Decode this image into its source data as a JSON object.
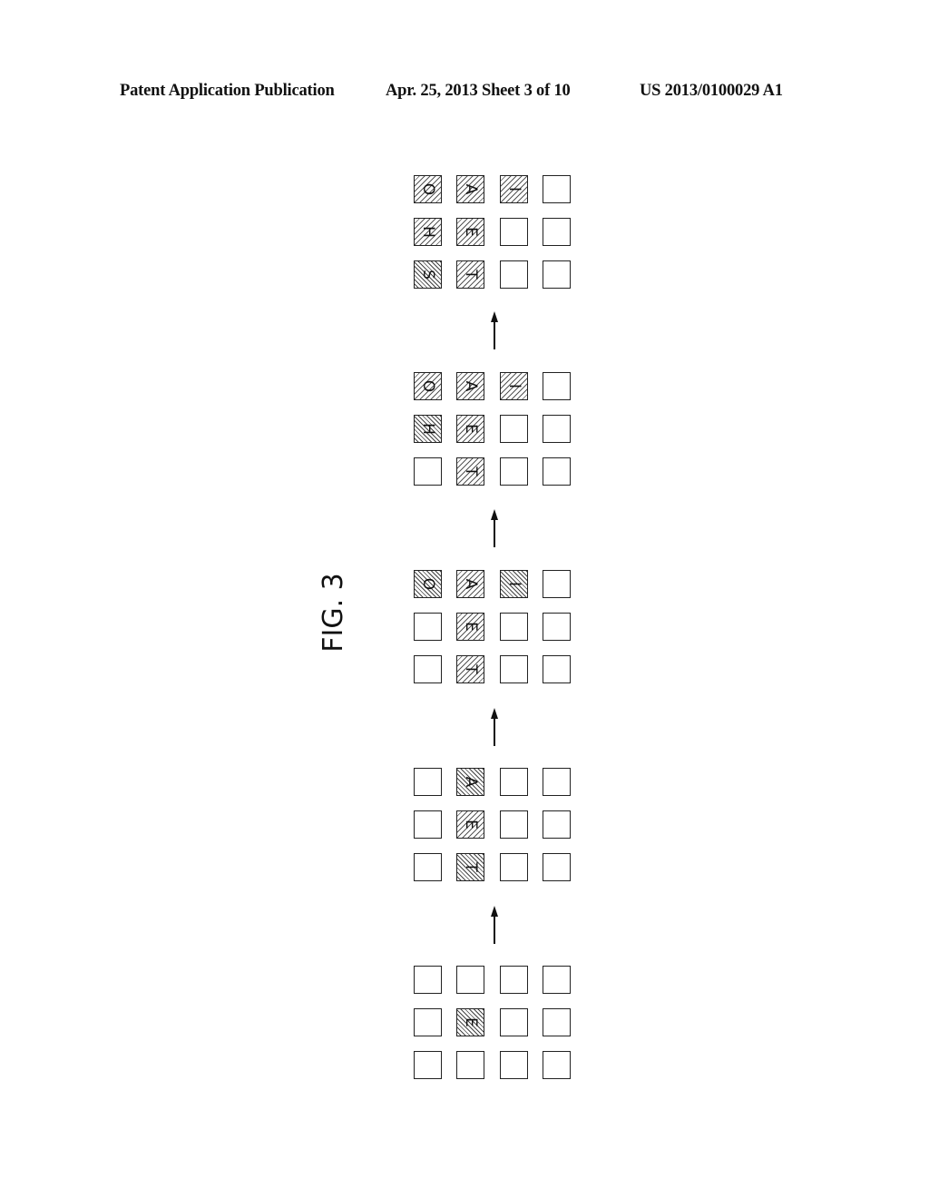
{
  "header": {
    "left": "Patent Application Publication",
    "middle": "Apr. 25, 2013  Sheet 3 of 10",
    "right": "US 2013/0100029 A1"
  },
  "figure": {
    "label": "FIG. 3",
    "grid_rows": 3,
    "grid_cols": 4,
    "arrow_direction": "up",
    "stages_top_to_bottom": [
      {
        "stage": 5,
        "cells": [
          [
            {
              "letter": "O",
              "hatch": "fwd"
            },
            {
              "letter": "A",
              "hatch": "fwd"
            },
            {
              "letter": "I",
              "hatch": "fwd"
            },
            {
              "letter": "",
              "hatch": "none"
            }
          ],
          [
            {
              "letter": "H",
              "hatch": "fwd"
            },
            {
              "letter": "E",
              "hatch": "fwd"
            },
            {
              "letter": "",
              "hatch": "none"
            },
            {
              "letter": "",
              "hatch": "none"
            }
          ],
          [
            {
              "letter": "S",
              "hatch": "back"
            },
            {
              "letter": "T",
              "hatch": "fwd"
            },
            {
              "letter": "",
              "hatch": "none"
            },
            {
              "letter": "",
              "hatch": "none"
            }
          ]
        ]
      },
      {
        "stage": 4,
        "cells": [
          [
            {
              "letter": "O",
              "hatch": "fwd"
            },
            {
              "letter": "A",
              "hatch": "fwd"
            },
            {
              "letter": "I",
              "hatch": "fwd"
            },
            {
              "letter": "",
              "hatch": "none"
            }
          ],
          [
            {
              "letter": "H",
              "hatch": "back"
            },
            {
              "letter": "E",
              "hatch": "fwd"
            },
            {
              "letter": "",
              "hatch": "none"
            },
            {
              "letter": "",
              "hatch": "none"
            }
          ],
          [
            {
              "letter": "",
              "hatch": "none"
            },
            {
              "letter": "T",
              "hatch": "fwd"
            },
            {
              "letter": "",
              "hatch": "none"
            },
            {
              "letter": "",
              "hatch": "none"
            }
          ]
        ]
      },
      {
        "stage": 3,
        "cells": [
          [
            {
              "letter": "O",
              "hatch": "back"
            },
            {
              "letter": "A",
              "hatch": "fwd"
            },
            {
              "letter": "I",
              "hatch": "back"
            },
            {
              "letter": "",
              "hatch": "none"
            }
          ],
          [
            {
              "letter": "",
              "hatch": "none"
            },
            {
              "letter": "E",
              "hatch": "fwd"
            },
            {
              "letter": "",
              "hatch": "none"
            },
            {
              "letter": "",
              "hatch": "none"
            }
          ],
          [
            {
              "letter": "",
              "hatch": "none"
            },
            {
              "letter": "T",
              "hatch": "fwd"
            },
            {
              "letter": "",
              "hatch": "none"
            },
            {
              "letter": "",
              "hatch": "none"
            }
          ]
        ]
      },
      {
        "stage": 2,
        "cells": [
          [
            {
              "letter": "",
              "hatch": "none"
            },
            {
              "letter": "A",
              "hatch": "back"
            },
            {
              "letter": "",
              "hatch": "none"
            },
            {
              "letter": "",
              "hatch": "none"
            }
          ],
          [
            {
              "letter": "",
              "hatch": "none"
            },
            {
              "letter": "E",
              "hatch": "fwd"
            },
            {
              "letter": "",
              "hatch": "none"
            },
            {
              "letter": "",
              "hatch": "none"
            }
          ],
          [
            {
              "letter": "",
              "hatch": "none"
            },
            {
              "letter": "T",
              "hatch": "back"
            },
            {
              "letter": "",
              "hatch": "none"
            },
            {
              "letter": "",
              "hatch": "none"
            }
          ]
        ]
      },
      {
        "stage": 1,
        "cells": [
          [
            {
              "letter": "",
              "hatch": "none"
            },
            {
              "letter": "",
              "hatch": "none"
            },
            {
              "letter": "",
              "hatch": "none"
            },
            {
              "letter": "",
              "hatch": "none"
            }
          ],
          [
            {
              "letter": "",
              "hatch": "none"
            },
            {
              "letter": "E",
              "hatch": "back"
            },
            {
              "letter": "",
              "hatch": "none"
            },
            {
              "letter": "",
              "hatch": "none"
            }
          ],
          [
            {
              "letter": "",
              "hatch": "none"
            },
            {
              "letter": "",
              "hatch": "none"
            },
            {
              "letter": "",
              "hatch": "none"
            },
            {
              "letter": "",
              "hatch": "none"
            }
          ]
        ]
      }
    ]
  }
}
